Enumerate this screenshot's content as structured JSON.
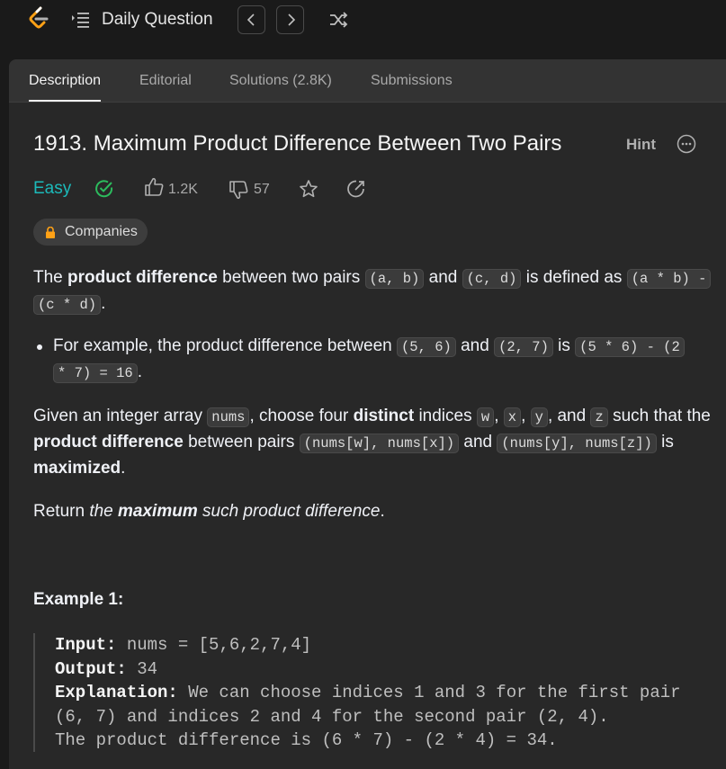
{
  "topbar": {
    "title": "Daily Question"
  },
  "tabs": [
    {
      "label": "Description"
    },
    {
      "label": "Editorial"
    },
    {
      "label": "Solutions (2.8K)"
    },
    {
      "label": "Submissions"
    }
  ],
  "problem": {
    "title": "1913. Maximum Product Difference Between Two Pairs",
    "hint_label": "Hint",
    "difficulty": "Easy",
    "likes": "1.2K",
    "dislikes": "57",
    "companies_label": "Companies"
  },
  "description": {
    "p1": {
      "t1": "The ",
      "b1": "product difference",
      "t2": " between two pairs ",
      "c1": "(a, b)",
      "t3": " and ",
      "c2": "(c, d)",
      "t4": " is defined as ",
      "c3a": "(a * b) -",
      "c3b": "(c * d)",
      "t5": "."
    },
    "bullet": {
      "t1": "For example, the product difference between ",
      "c1": "(5, 6)",
      "t2": " and ",
      "c2": "(2, 7)",
      "t3": " is ",
      "c3a": "(5 * 6) - (2",
      "c3b": "* 7) = 16",
      "t4": "."
    },
    "p2": {
      "t1": "Given an integer array ",
      "c1": "nums",
      "t2": ", choose four ",
      "b1": "distinct",
      "t3": " indices ",
      "c2": "w",
      "t4": ", ",
      "c3": "x",
      "t5": ", ",
      "c4": "y",
      "t6": ", and ",
      "c5": "z",
      "t7": " such that the",
      "b2": "product difference",
      "t8": " between pairs ",
      "c6": "(nums[w], nums[x])",
      "t9": " and ",
      "c7": "(nums[y], nums[z])",
      "t10": " is",
      "b3": "maximized",
      "t11": "."
    },
    "p3": {
      "t1": "Return ",
      "i1": "the ",
      "bi": "maximum",
      "i2": " such product difference",
      "t2": "."
    }
  },
  "example1": {
    "title": "Example 1:",
    "input_label": "Input:",
    "input_value": " nums = [5,6,2,7,4]",
    "output_label": "Output:",
    "output_value": " 34",
    "explanation_label": "Explanation:",
    "explanation_line1": " We can choose indices 1 and 3 for the first pair",
    "explanation_line2": "(6, 7) and indices 2 and 4 for the second pair (2, 4).",
    "explanation_line3": "The product difference is (6 * 7) - (2 * 4) = 34."
  },
  "colors": {
    "easy": "#1cbaba",
    "solved": "#2cbb5d",
    "logo_orange": "#ffa116"
  }
}
